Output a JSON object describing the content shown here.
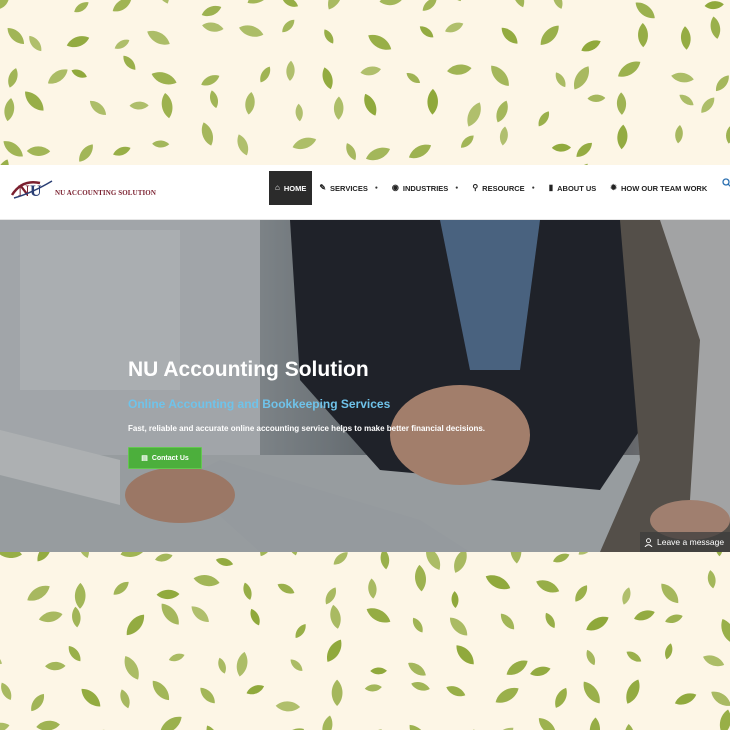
{
  "brand": {
    "logo_mark": "NU",
    "logo_text": "NU ACCOUNTING SOLUTION"
  },
  "nav": {
    "items": [
      {
        "label": "HOME",
        "icon": "home-icon",
        "glyph": "⌂",
        "has_caret": false
      },
      {
        "label": "SERVICES",
        "icon": "wrench-icon",
        "glyph": "✎",
        "has_caret": true
      },
      {
        "label": "INDUSTRIES",
        "icon": "globe-icon",
        "glyph": "◉",
        "has_caret": true
      },
      {
        "label": "RESOURCE",
        "icon": "search-icon",
        "glyph": "⚲",
        "has_caret": true
      },
      {
        "label": "ABOUT US",
        "icon": "book-icon",
        "glyph": "▮",
        "has_caret": false
      },
      {
        "label": "HOW OUR TEAM WORK",
        "icon": "gear-icon",
        "glyph": "✹",
        "has_caret": false
      }
    ]
  },
  "hero": {
    "title": "NU Accounting Solution",
    "subtitle": "Online Accounting and Bookkeeping Services",
    "description": "Fast, reliable and accurate online accounting service helps to make better financial decisions.",
    "cta_label": "Contact Us"
  },
  "chat": {
    "label": "Leave a message"
  },
  "colors": {
    "pattern_bg": "#fdf6e6",
    "leaf": "#8fa83a",
    "nav_active_bg": "#2b2b2b",
    "subtitle": "#6fc3ea",
    "cta_bg": "#4caf3c",
    "brand": "#7a1f2e"
  }
}
